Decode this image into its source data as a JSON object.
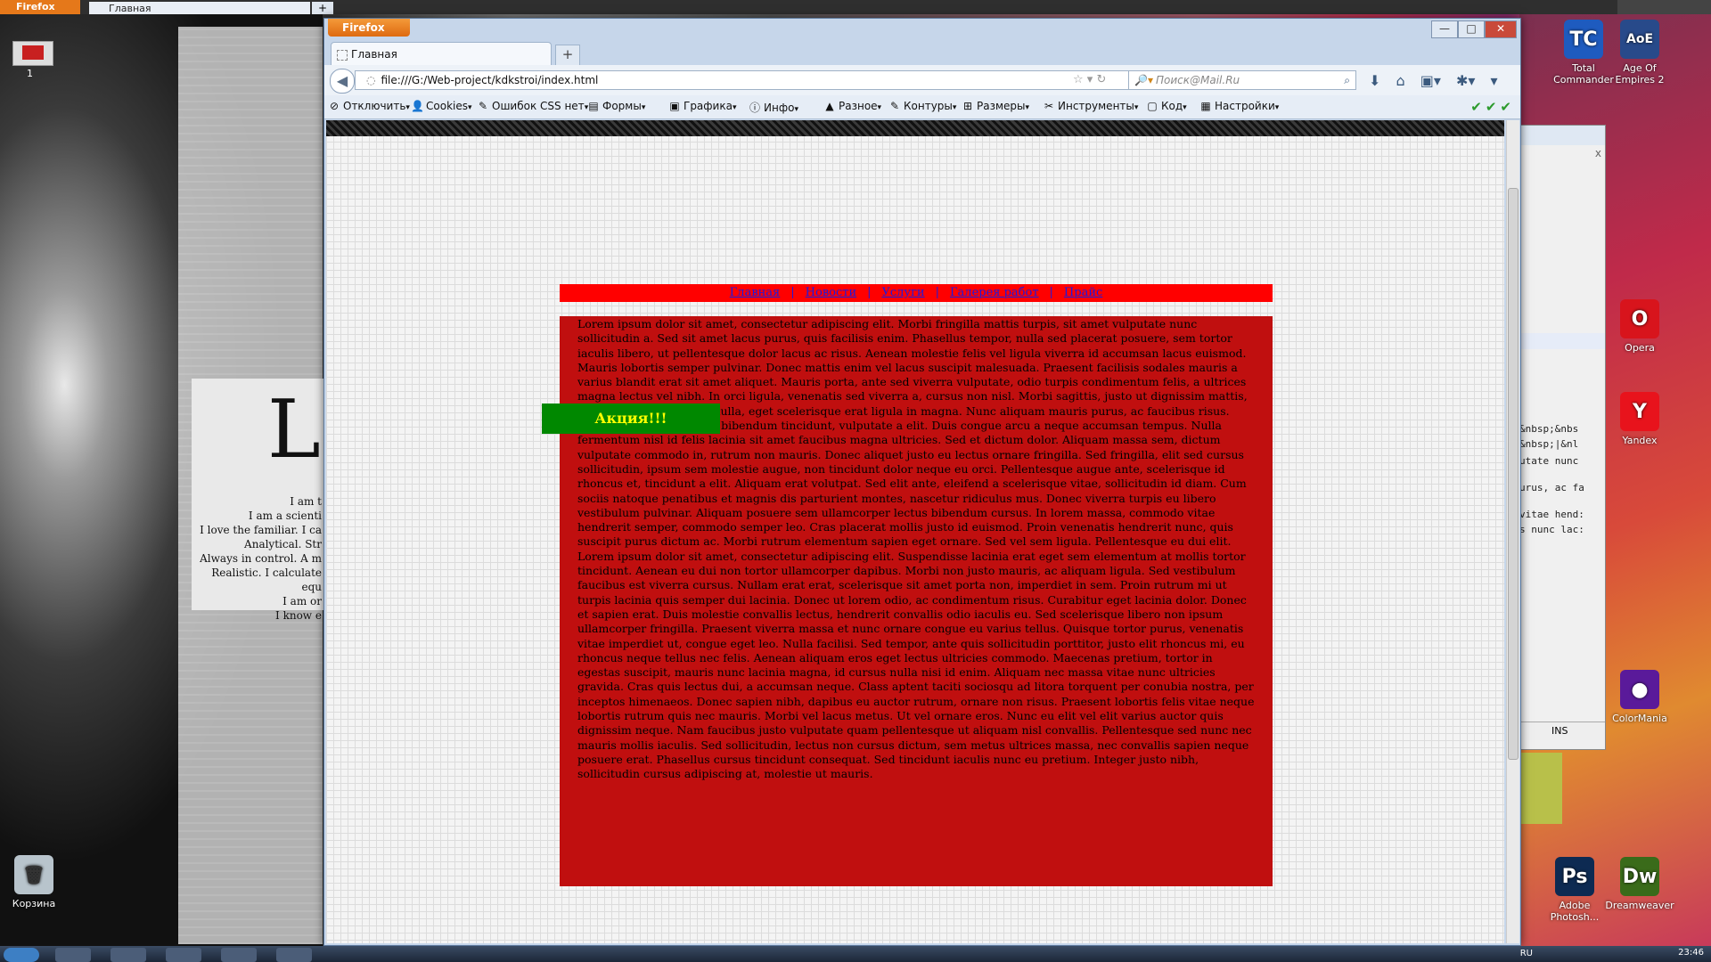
{
  "background_window": {
    "app_button": "Firefox",
    "tab_title": "Главная",
    "new_tab": "+"
  },
  "desktop": {
    "left_icon_badge": "1",
    "recycle_bin": "Корзина",
    "art_big_letters": "Lo",
    "art_text_lines": [
      "I am t",
      "I am a scienti",
      "I love the familiar. I ca",
      "Analytical. Str",
      "Always in control. A m",
      "Realistic. I calculate equ",
      "I am or",
      "I know e"
    ],
    "icons": [
      {
        "label": "Total Commander",
        "color": "#1e5bbf",
        "glyph": "TC"
      },
      {
        "label": "Age Of Empires 2",
        "color": "#284a8a",
        "glyph": "AoE"
      },
      {
        "label": "Opera",
        "color": "#d8141c",
        "glyph": "O"
      },
      {
        "label": "Yandex",
        "color": "#e8131c",
        "glyph": "Y"
      },
      {
        "label": "ColorMania",
        "color": "#5a1a9a",
        "glyph": "●"
      },
      {
        "label": "Adobe Photosh...",
        "color": "#0d2a52",
        "glyph": "Ps"
      },
      {
        "label": "Dreamweaver",
        "color": "#3a6b1a",
        "glyph": "Dw"
      }
    ]
  },
  "window2": {
    "lines": [
      "&nbsp;&nbs",
      "&nbsp;|&nl",
      "utate nunc",
      "urus, ac fa",
      "vitae hend:",
      "s nunc lac:"
    ],
    "status": "INS"
  },
  "firefox": {
    "app_button": "Firefox",
    "controls": {
      "min": "—",
      "max": "□",
      "close": "✕"
    },
    "tab_title": "Главная",
    "new_tab": "+",
    "url": "file:///G:/Web-project/kdkstroi/index.html",
    "search_placeholder": "Поиск@Mail.Ru",
    "toolbar": [
      {
        "label": "Отключить",
        "icon": "⊘"
      },
      {
        "label": "Cookies",
        "icon": "👤"
      },
      {
        "label": "Ошибок CSS нет",
        "icon": "✎"
      },
      {
        "label": "Формы",
        "icon": "▤"
      },
      {
        "label": "Графика",
        "icon": "▣"
      },
      {
        "label": "Инфо",
        "icon": "ⓘ"
      },
      {
        "label": "Разное",
        "icon": "▲"
      },
      {
        "label": "Контуры",
        "icon": "✎"
      },
      {
        "label": "Размеры",
        "icon": "⊞"
      },
      {
        "label": "Инструменты",
        "icon": "✂"
      },
      {
        "label": "Код",
        "icon": "▢"
      },
      {
        "label": "Настройки",
        "icon": "▦"
      }
    ],
    "checks": "✔✔✔"
  },
  "page": {
    "nav": [
      "Главная",
      "Новости",
      "Услуги",
      "Галерея работ",
      "Прайс"
    ],
    "nav_separator": "|",
    "promo": "Акция!!!",
    "content": "Lorem ipsum dolor sit amet, consectetur adipiscing elit. Morbi fringilla mattis turpis, sit amet vulputate nunc sollicitudin a. Sed sit amet lacus purus, quis facilisis enim. Phasellus tempor, nulla sed placerat posuere, sem tortor iaculis libero, ut pellentesque dolor lacus ac risus. Aenean molestie felis vel ligula viverra id accumsan lacus euismod. Mauris lobortis semper pulvinar. Donec mattis enim vel lacus suscipit malesuada. Praesent facilisis sodales mauris a varius blandit erat sit amet aliquet. Mauris porta, ante sed viverra vulputate, odio turpis condimentum felis, a ultrices magna lectus vel nibh. In orci ligula, venenatis sed viverra a, cursus non nisl. Morbi sagittis, justo ut dignissim mattis, mauris ligula commodo nulla, eget scelerisque erat ligula in magna. Nunc aliquam mauris purus, ac faucibus risus. Cras leo lectus, luctus at bibendum tincidunt, vulputate a elit. Duis congue arcu a neque accumsan tempus. Nulla fermentum nisl id felis lacinia sit amet faucibus magna ultricies. Sed et dictum dolor. Aliquam massa sem, dictum vulputate commodo in, rutrum non mauris. Donec aliquet justo eu lectus ornare fringilla. Sed fringilla, elit sed cursus sollicitudin, ipsum sem molestie augue, non tincidunt dolor neque eu orci. Pellentesque augue ante, scelerisque id rhoncus et, tincidunt a elit. Aliquam erat volutpat. Sed elit ante, eleifend a scelerisque vitae, sollicitudin id diam. Cum sociis natoque penatibus et magnis dis parturient montes, nascetur ridiculus mus. Donec viverra turpis eu libero vestibulum pulvinar. Aliquam posuere sem ullamcorper lectus bibendum cursus. In lorem massa, commodo vitae hendrerit semper, commodo semper leo. Cras placerat mollis justo id euismod. Proin venenatis hendrerit nunc, quis suscipit purus dictum ac. Morbi rutrum elementum sapien eget ornare. Sed vel sem ligula. Pellentesque eu dui elit. Lorem ipsum dolor sit amet, consectetur adipiscing elit. Suspendisse lacinia erat eget sem elementum at mollis tortor tincidunt. Aenean eu dui non tortor ullamcorper dapibus. Morbi non justo mauris, ac aliquam ligula. Sed vestibulum faucibus est viverra cursus. Nullam erat erat, scelerisque sit amet porta non, imperdiet in sem. Proin rutrum mi ut turpis lacinia quis semper dui lacinia. Donec ut lorem odio, ac condimentum risus. Curabitur eget lacinia dolor. Donec et sapien erat. Duis molestie convallis lectus, hendrerit convallis odio iaculis eu. Sed scelerisque libero non ipsum ullamcorper fringilla. Praesent viverra massa et nunc ornare congue eu varius tellus. Quisque tortor purus, venenatis vitae imperdiet ut, congue eget leo. Nulla facilisi. Sed tempor, ante quis sollicitudin porttitor, justo elit rhoncus mi, eu rhoncus neque tellus nec felis. Aenean aliquam eros eget lectus ultricies commodo. Maecenas pretium, tortor in egestas suscipit, mauris nunc lacinia magna, id cursus nulla nisi id enim. Aliquam nec massa vitae nunc ultricies gravida. Cras quis lectus dui, a accumsan neque. Class aptent taciti sociosqu ad litora torquent per conubia nostra, per inceptos himenaeos. Donec sapien nibh, dapibus eu auctor rutrum, ornare non risus. Praesent lobortis felis vitae neque lobortis rutrum quis nec mauris. Morbi vel lacus metus. Ut vel ornare eros. Nunc eu elit vel elit varius auctor quis dignissim neque. Nam faucibus justo vulputate quam pellentesque ut aliquam nisl convallis. Pellentesque sed nunc nec mauris mollis iaculis. Sed sollicitudin, lectus non cursus dictum, sem metus ultrices massa, nec convallis sapien neque posuere erat. Phasellus cursus tincidunt consequat. Sed tincidunt iaculis nunc eu pretium. Integer justo nibh, sollicitudin cursus adipiscing at, molestie ut mauris."
  },
  "taskbar": {
    "lang": "RU",
    "time": "23:46"
  }
}
